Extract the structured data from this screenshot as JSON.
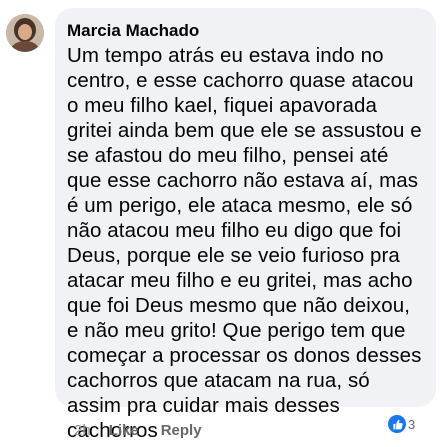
{
  "comment": {
    "author": "Marcia Machado",
    "text": "Um tempo atrás eu estava indo no centro, e esse cachorro quase atacou o meu filho kael, fiquei apavorada gritei ainda bem que ele se assustou e se afastou do meu filho,  pensei até que esse cachorro não estava aí,  mas é um perigo,  ele ataca mesmo, ele só não atacou meu filho eu digo que foi Deus, porque ele se veio furioso pra atacar meu filho e eu gritei,  mas acho que foi Deus mesmo que não deixou, e não meu grito! Que perigo tem que começar a processar os donos desses cachorros que atacam na rua, só assim pra cuidar mais desses cachorros"
  },
  "actions": {
    "time": "2h",
    "like_label": "Like",
    "reply_label": "Reply"
  },
  "reactions": {
    "icon": "like-reaction-icon",
    "count": "3",
    "color": "#1877f2"
  },
  "colors": {
    "bubble_bg": "#f0f2f5",
    "text": "#050505",
    "secondary": "#65676b"
  }
}
